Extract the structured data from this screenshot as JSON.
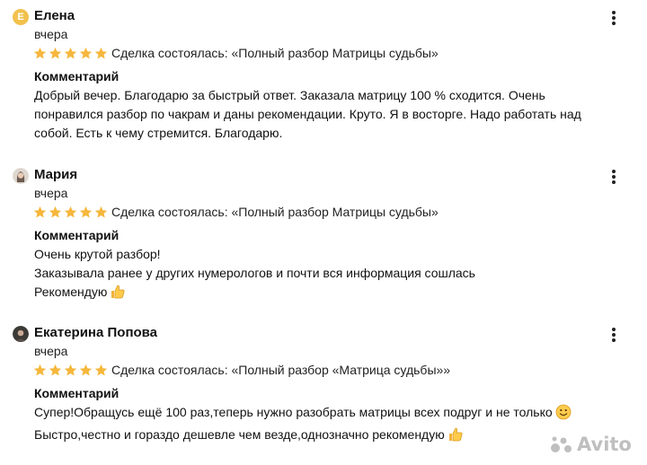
{
  "reviews": [
    {
      "author": "Елена",
      "avatar_letter": "Е",
      "date": "вчера",
      "rating": 5,
      "deal": "Сделка состоялась: «Полный разбор Матрицы судьбы»",
      "comment_title": "Комментарий",
      "lines": [
        "Добрый вечер. Благодарю за быстрый ответ. Заказала матрицу 100 % сходится. Очень",
        "понравился разбор по чакрам и даны рекомендации. Круто. Я в восторге. Надо работать над",
        "собой. Есть к чему стремится. Благодарю."
      ]
    },
    {
      "author": "Мария",
      "date": "вчера",
      "rating": 5,
      "deal": "Сделка состоялась: «Полный разбор Матрицы судьбы»",
      "comment_title": "Комментарий",
      "lines": [
        "Очень крутой разбор!",
        "Заказывала ранее у других нумерологов и почти вся информация сошлась",
        "Рекомендую"
      ]
    },
    {
      "author": "Екатерина Попова",
      "date": "вчера",
      "rating": 5,
      "deal": "Сделка состоялась: «Полный разбор «Матрица судьбы»»",
      "comment_title": "Комментарий",
      "lines": [
        "Супер!Обращусь ещё 100 раз,теперь нужно разобрать матрицы всех подруг и не только",
        "Быстро,честно и гораздо дешевле чем везде,однозначно рекомендую"
      ]
    }
  ],
  "watermark": "Avito",
  "colors": {
    "star": "#f6b73c",
    "text": "#111111",
    "watermark": "#b4b4b4"
  }
}
